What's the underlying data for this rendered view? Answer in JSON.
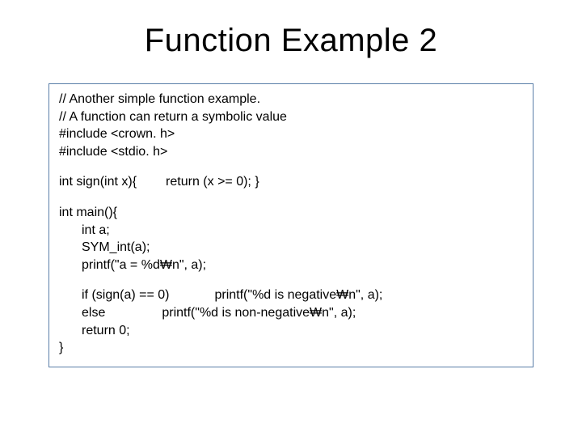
{
  "title": "Function Example 2",
  "code": {
    "c1": "// Another simple function example.",
    "c2": "// A function can return a symbolic value",
    "c3": "#include <crown. h>",
    "c4": "#include <stdio. h>",
    "c5a": "int sign(int x){",
    "c5b": "return (x >= 0); }",
    "c6": "int main(){",
    "c7": "int a;",
    "c8": "SYM_int(a);",
    "c9": "printf(\"a = %d₩n\", a);",
    "c10a": "if (sign(a) == 0)",
    "c10b": "printf(\"%d is negative₩n\", a);",
    "c11a": "else",
    "c11b": "printf(\"%d is non-negative₩n\", a);",
    "c12": "return 0;",
    "c13": "}"
  }
}
